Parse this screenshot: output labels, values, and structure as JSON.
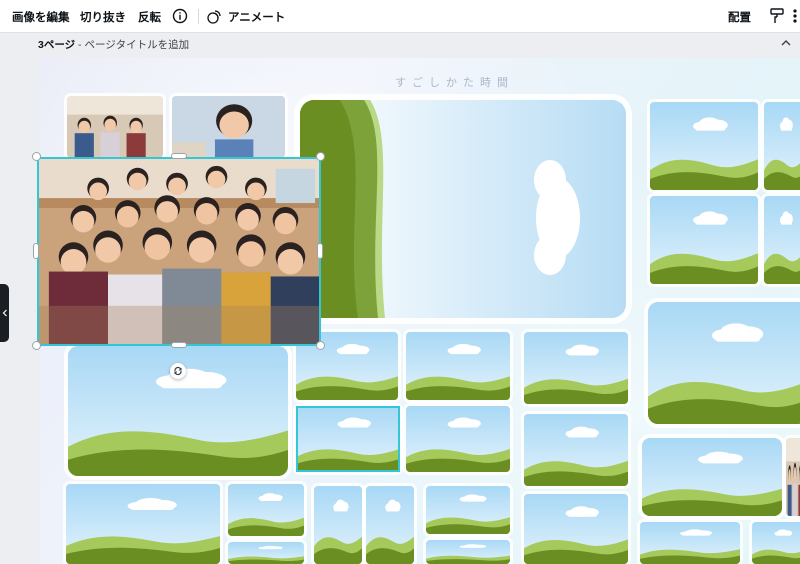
{
  "toolbar": {
    "edit_image": "画像を編集",
    "crop": "切り抜き",
    "flip": "反転",
    "animate": "アニメート",
    "position": "配置"
  },
  "page": {
    "number_label": "3ページ",
    "separator": " - ",
    "title_placeholder": "ページタイトルを追加"
  },
  "canvas": {
    "heading": "すごしかた時間"
  },
  "colors": {
    "accent": "#35c6d6",
    "sky": "#bfe3f7",
    "grass_dark": "#6b8e23",
    "grass_light": "#a5c95a"
  }
}
